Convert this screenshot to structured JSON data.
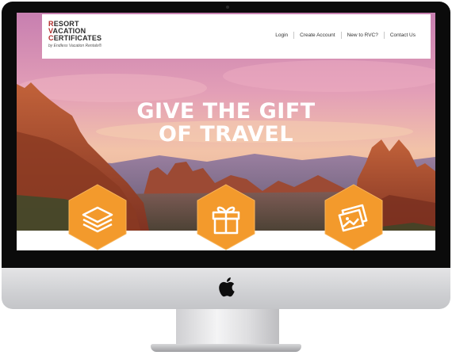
{
  "logo": {
    "line1_initial": "R",
    "line1_rest": "ESORT",
    "line2_initial": "V",
    "line2_rest": "ACATION",
    "line3_initial": "C",
    "line3_rest": "ERTIFICATES",
    "tagline": "by Endless Vacation Rentals®"
  },
  "nav": {
    "login": "Login",
    "create_account": "Create Account",
    "new_to": "New to RVC?",
    "contact": "Contact Us"
  },
  "hero": {
    "headline_line1": "GIVE THE GIFT",
    "headline_line2": "OF TRAVEL"
  },
  "icons": [
    "stack-icon",
    "gift-icon",
    "photos-icon"
  ],
  "colors": {
    "accent_orange": "#f39a2c",
    "logo_red": "#b22b2b",
    "sky_pink": "#d98ab0",
    "rock_red": "#a8442a"
  }
}
